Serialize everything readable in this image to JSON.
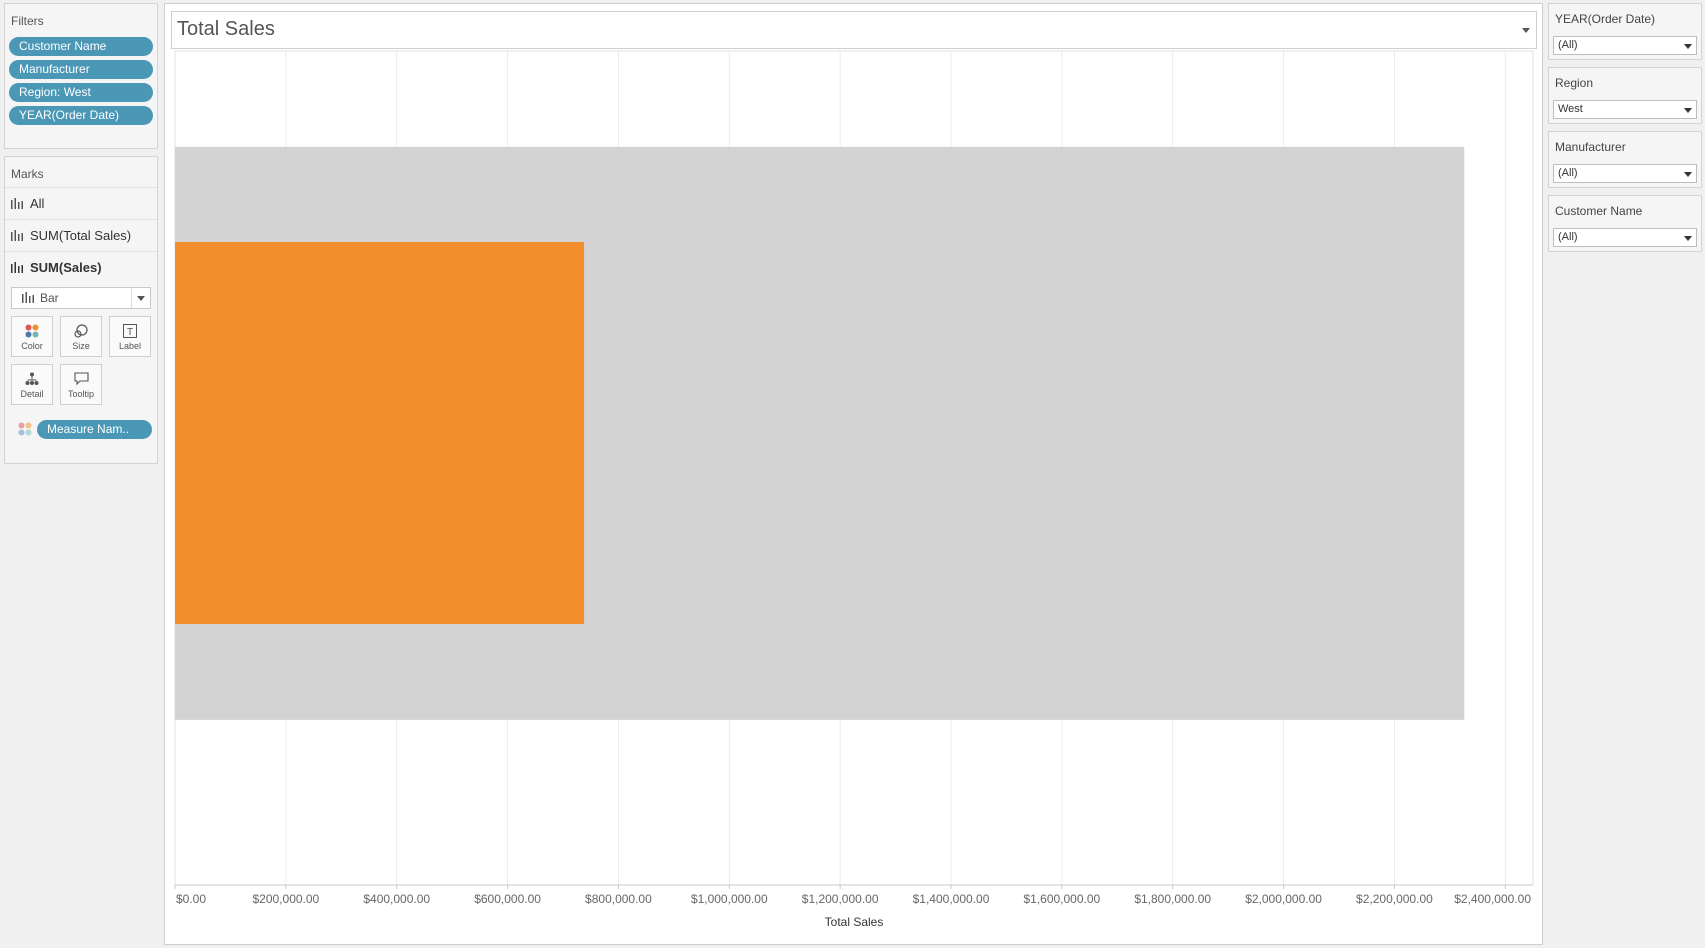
{
  "filters": {
    "title": "Filters",
    "pills": [
      "Customer Name",
      "Manufacturer",
      "Region: West",
      "YEAR(Order Date)"
    ]
  },
  "marks": {
    "title": "Marks",
    "rows": [
      "All",
      "SUM(Total Sales)",
      "SUM(Sales)"
    ],
    "mark_type": "Bar",
    "cards": [
      "Color",
      "Size",
      "Label",
      "Detail",
      "Tooltip"
    ],
    "color_pill": "Measure Nam.."
  },
  "view": {
    "title": "Total Sales"
  },
  "quick_filters": [
    {
      "label": "YEAR(Order Date)",
      "value": "(All)"
    },
    {
      "label": "Region",
      "value": "West"
    },
    {
      "label": "Manufacturer",
      "value": "(All)"
    },
    {
      "label": "Customer Name",
      "value": "(All)"
    }
  ],
  "colors": {
    "accent_pill": "#4a97b6",
    "sales_bar": "#f28e2b",
    "total_sales_bar": "#d3d3d3"
  },
  "chart_data": {
    "type": "bar",
    "orientation": "horizontal",
    "xlabel": "Total Sales",
    "xlim": [
      0,
      2450000
    ],
    "x_ticks": [
      "$0.00",
      "$200,000.00",
      "$400,000.00",
      "$600,000.00",
      "$800,000.00",
      "$1,000,000.00",
      "$1,200,000.00",
      "$1,400,000.00",
      "$1,600,000.00",
      "$1,800,000.00",
      "$2,000,000.00",
      "$2,200,000.00",
      "$2,400,000.00"
    ],
    "tick_values": [
      0,
      200000,
      400000,
      600000,
      800000,
      1000000,
      1200000,
      1400000,
      1600000,
      1800000,
      2000000,
      2200000,
      2400000
    ],
    "grid": true,
    "series": [
      {
        "value": 2326000,
        "color": "#d3d3d3"
      },
      {
        "value": 738000,
        "color": "#f28e2b"
      }
    ]
  }
}
